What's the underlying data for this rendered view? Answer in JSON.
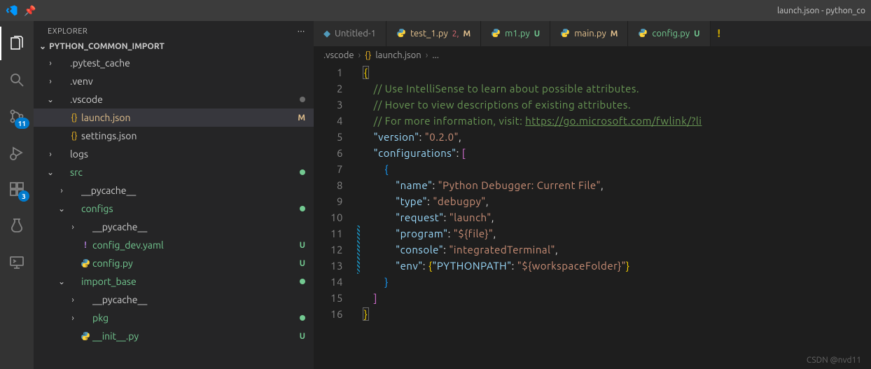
{
  "window": {
    "title": "launch.json - python_co"
  },
  "activity": {
    "scm_badge": "11",
    "extensions_badge": "3"
  },
  "sidebar": {
    "title": "EXPLORER",
    "section": "PYTHON_COMMON_IMPORT"
  },
  "tree": [
    {
      "depth": 1,
      "chev": ">",
      "icon": "",
      "label": ".pytest_cache",
      "cls": "",
      "status": "",
      "dot": ""
    },
    {
      "depth": 1,
      "chev": ">",
      "icon": "",
      "label": ".venv",
      "cls": "",
      "status": "",
      "dot": ""
    },
    {
      "depth": 1,
      "chev": "v",
      "icon": "",
      "label": ".vscode",
      "cls": "",
      "status": "",
      "dot": "grey"
    },
    {
      "depth": 2,
      "chev": "",
      "icon": "{}",
      "iconcls": "icon-yellow",
      "label": "launch.json",
      "cls": "label-yellow",
      "status": "M",
      "dot": "",
      "selected": true
    },
    {
      "depth": 2,
      "chev": "",
      "icon": "{}",
      "iconcls": "icon-yellow",
      "label": "settings.json",
      "cls": "",
      "status": "",
      "dot": ""
    },
    {
      "depth": 1,
      "chev": ">",
      "icon": "",
      "label": "logs",
      "cls": "",
      "status": "",
      "dot": ""
    },
    {
      "depth": 1,
      "chev": "v",
      "icon": "",
      "label": "src",
      "cls": "label-green",
      "status": "",
      "dot": "green"
    },
    {
      "depth": 2,
      "chev": ">",
      "icon": "",
      "label": "__pycache__",
      "cls": "",
      "status": "",
      "dot": ""
    },
    {
      "depth": 2,
      "chev": "v",
      "icon": "",
      "label": "configs",
      "cls": "label-green",
      "status": "",
      "dot": "green"
    },
    {
      "depth": 3,
      "chev": ">",
      "icon": "",
      "label": "__pycache__",
      "cls": "",
      "status": "",
      "dot": ""
    },
    {
      "depth": 3,
      "chev": "",
      "icon": "!",
      "iconcls": "icon-purple",
      "label": "config_dev.yaml",
      "cls": "label-green",
      "status": "U",
      "dot": ""
    },
    {
      "depth": 3,
      "chev": "",
      "icon": "py",
      "iconcls": "icon-blue",
      "label": "config.py",
      "cls": "label-green",
      "status": "U",
      "dot": ""
    },
    {
      "depth": 2,
      "chev": "v",
      "icon": "",
      "label": "import_base",
      "cls": "label-green",
      "status": "",
      "dot": "green"
    },
    {
      "depth": 3,
      "chev": ">",
      "icon": "",
      "label": "__pycache__",
      "cls": "",
      "status": "",
      "dot": ""
    },
    {
      "depth": 3,
      "chev": ">",
      "icon": "",
      "label": "pkg",
      "cls": "label-green",
      "status": "",
      "dot": "green"
    },
    {
      "depth": 3,
      "chev": "",
      "icon": "py",
      "iconcls": "icon-blue",
      "label": "__init__.py",
      "cls": "label-green",
      "status": "U",
      "dot": ""
    }
  ],
  "tabs": [
    {
      "icon": "◆",
      "iconcls": "icon-blue",
      "label": "Untitled-1",
      "num": "",
      "st": "",
      "stcls": ""
    },
    {
      "icon": "py",
      "iconcls": "icon-blue",
      "label": "test_1.py",
      "num": "2",
      "st": "M",
      "stcls": "st-M",
      "modlabel": true
    },
    {
      "icon": "py",
      "iconcls": "icon-blue",
      "label": "m1.py",
      "num": "",
      "st": "U",
      "stcls": "st-U"
    },
    {
      "icon": "py",
      "iconcls": "icon-blue",
      "label": "main.py",
      "num": "",
      "st": "M",
      "stcls": "st-M",
      "modlabel": true
    },
    {
      "icon": "py",
      "iconcls": "icon-blue",
      "label": "config.py",
      "num": "",
      "st": "U",
      "stcls": "st-U"
    }
  ],
  "breadcrumb": {
    "folder": ".vscode",
    "icon": "{}",
    "file": "launch.json",
    "tail": "..."
  },
  "code": {
    "lines": [
      1,
      2,
      3,
      4,
      5,
      6,
      7,
      8,
      9,
      10,
      11,
      12,
      13,
      14,
      15,
      16
    ],
    "c1": "// Use IntelliSense to learn about possible attributes.",
    "c2": "// Hover to view descriptions of existing attributes.",
    "c3a": "// For more information, visit: ",
    "c3b": "https://go.microsoft.com/fwlink/?li",
    "version_k": "\"version\"",
    "version_v": "\"0.2.0\"",
    "config_k": "\"configurations\"",
    "name_k": "\"name\"",
    "name_v": "\"Python Debugger: Current File\"",
    "type_k": "\"type\"",
    "type_v": "\"debugpy\"",
    "request_k": "\"request\"",
    "request_v": "\"launch\"",
    "program_k": "\"program\"",
    "program_v": "\"${file}\"",
    "console_k": "\"console\"",
    "console_v": "\"integratedTerminal\"",
    "env_k": "\"env\"",
    "pp_k": "\"PYTHONPATH\"",
    "pp_v": "\"${workspaceFolder}\""
  },
  "watermark": "CSDN @nvd11"
}
